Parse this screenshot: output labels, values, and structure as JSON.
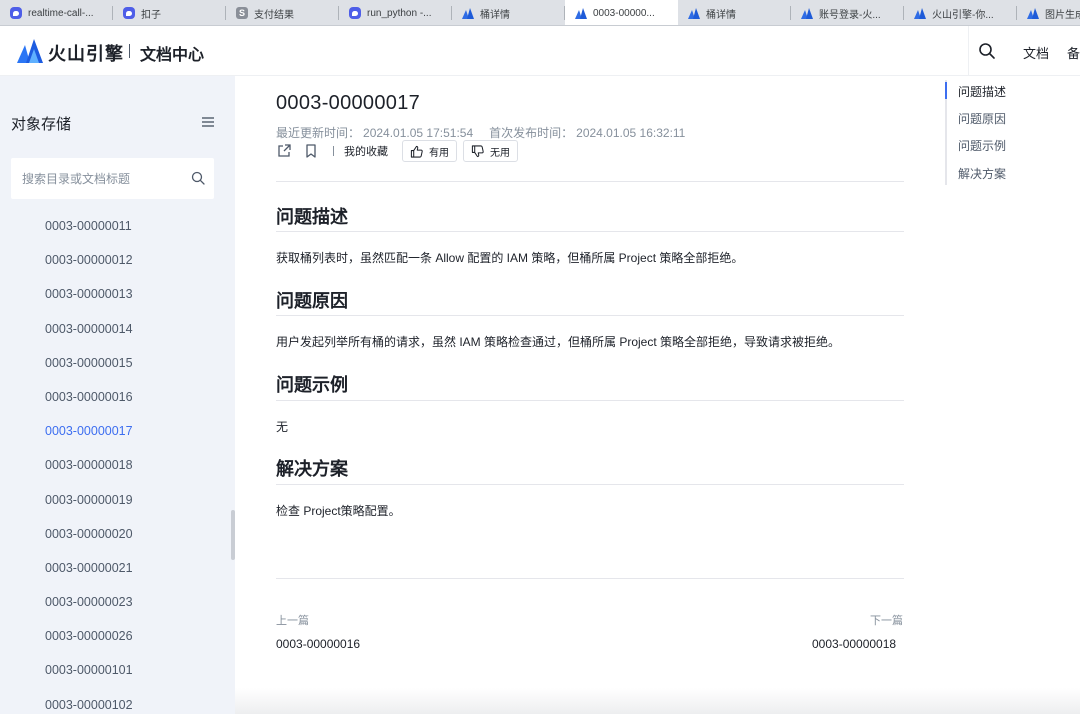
{
  "browser": {
    "tabs": [
      {
        "label": "realtime-call-...",
        "icon": "chat-bot-icon",
        "active": false
      },
      {
        "label": "扣子",
        "icon": "chat-bot-icon",
        "active": false
      },
      {
        "label": "支付结果",
        "icon": "s-letter-icon",
        "active": false
      },
      {
        "label": "run_python -...",
        "icon": "chat-bot-icon",
        "active": false
      },
      {
        "label": "桶详情",
        "icon": "volcano-logo-icon",
        "active": false
      },
      {
        "label": "0003-00000...",
        "icon": "volcano-logo-icon",
        "active": true
      },
      {
        "label": "桶详情",
        "icon": "volcano-logo-icon",
        "active": false
      },
      {
        "label": "账号登录-火...",
        "icon": "volcano-logo-icon",
        "active": false
      },
      {
        "label": "火山引擎-你...",
        "icon": "volcano-logo-icon",
        "active": false
      },
      {
        "label": "图片生成 A",
        "icon": "volcano-logo-icon",
        "active": false
      }
    ]
  },
  "header": {
    "brand": "火山引擎",
    "section": "文档中心",
    "links": [
      "文档",
      "备"
    ]
  },
  "sidebar": {
    "title": "对象存储",
    "search_placeholder": "搜索目录或文档标题",
    "items": [
      {
        "label": "0003-00000011",
        "active": false
      },
      {
        "label": "0003-00000012",
        "active": false
      },
      {
        "label": "0003-00000013",
        "active": false
      },
      {
        "label": "0003-00000014",
        "active": false
      },
      {
        "label": "0003-00000015",
        "active": false
      },
      {
        "label": "0003-00000016",
        "active": false
      },
      {
        "label": "0003-00000017",
        "active": true
      },
      {
        "label": "0003-00000018",
        "active": false
      },
      {
        "label": "0003-00000019",
        "active": false
      },
      {
        "label": "0003-00000020",
        "active": false
      },
      {
        "label": "0003-00000021",
        "active": false
      },
      {
        "label": "0003-00000023",
        "active": false
      },
      {
        "label": "0003-00000026",
        "active": false
      },
      {
        "label": "0003-00000101",
        "active": false
      },
      {
        "label": "0003-00000102",
        "active": false
      }
    ]
  },
  "article": {
    "title": "0003-00000017",
    "updated_label": "最近更新时间：",
    "updated_value": "2024.01.05 17:51:54",
    "published_label": "首次发布时间：",
    "published_value": "2024.01.05 16:32:11",
    "favorite_label": "我的收藏",
    "useful_label": "有用",
    "useless_label": "无用",
    "sections": [
      {
        "heading": "问题描述",
        "body": "获取桶列表时，虽然匹配一条 Allow 配置的 IAM 策略，但桶所属 Project 策略全部拒绝。"
      },
      {
        "heading": "问题原因",
        "body": "用户发起列举所有桶的请求，虽然 IAM 策略检查通过，但桶所属 Project 策略全部拒绝，导致请求被拒绝。"
      },
      {
        "heading": "问题示例",
        "body": "无"
      },
      {
        "heading": "解决方案",
        "body": "检查 Project策略配置。"
      }
    ],
    "prev_label": "上一篇",
    "prev_title": "0003-00000016",
    "next_label": "下一篇",
    "next_title": "0003-00000018"
  },
  "toc": {
    "items": [
      {
        "label": "问题描述",
        "active": true
      },
      {
        "label": "问题原因",
        "active": false
      },
      {
        "label": "问题示例",
        "active": false
      },
      {
        "label": "解决方案",
        "active": false
      }
    ]
  },
  "colors": {
    "accent": "#3d6ef0",
    "sidebar_bg": "#f0f3f9",
    "text_primary": "#1d2129",
    "text_secondary": "#86909c"
  }
}
